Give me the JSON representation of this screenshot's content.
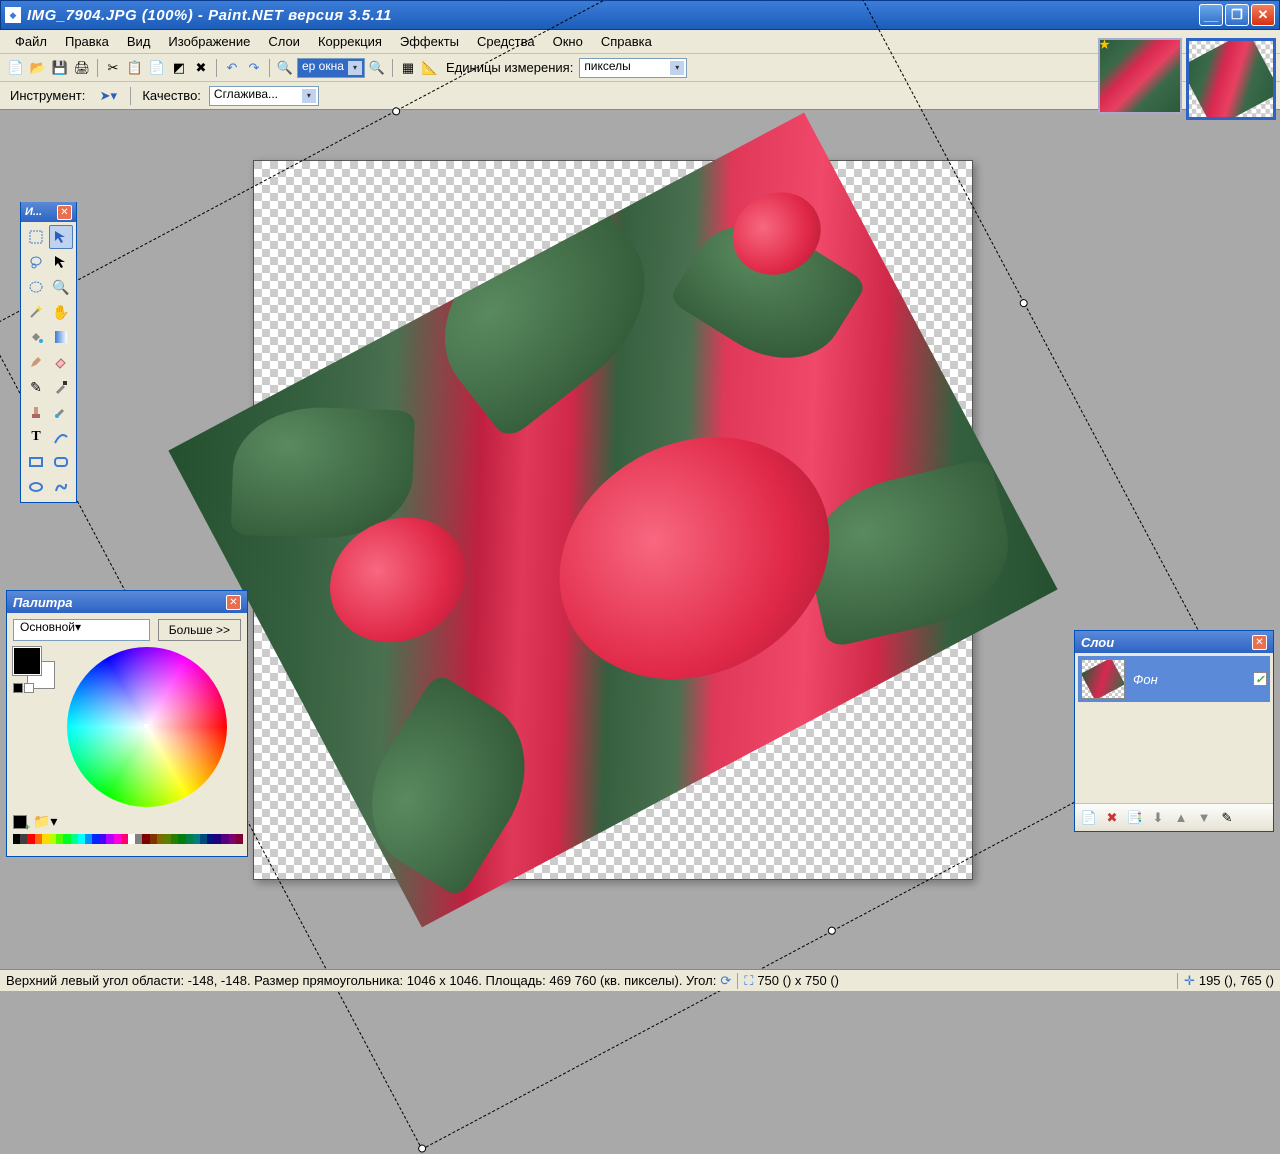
{
  "titlebar": {
    "text": "IMG_7904.JPG (100%) - Paint.NET версия 3.5.11"
  },
  "menu": {
    "items": [
      "Файл",
      "Правка",
      "Вид",
      "Изображение",
      "Слои",
      "Коррекция",
      "Эффекты",
      "Средства",
      "Окно",
      "Справка"
    ]
  },
  "toolbar1": {
    "zoom_combo": "ер окна",
    "units_label": "Единицы измерения:",
    "units_value": "пикселы"
  },
  "toolbar2": {
    "tool_label": "Инструмент:",
    "quality_label": "Качество:",
    "quality_value": "Сглажива..."
  },
  "tools_panel": {
    "title": "И..."
  },
  "colors_panel": {
    "title": "Палитра",
    "mode": "Основной",
    "more": "Больше >>"
  },
  "layers_panel": {
    "title": "Слои",
    "layer0": "Фон"
  },
  "status": {
    "region": "Верхний левый угол области: -148, -148. Размер прямоугольника: 1046 х 1046. Площадь: 469 760 (кв. пикселы). Угол:",
    "size": "750 () x 750 ()",
    "cursor": "195 (), 765 ()"
  },
  "swatch_colors": [
    "#000",
    "#404040",
    "#ff0000",
    "#ff6a00",
    "#ffd800",
    "#b6ff00",
    "#4cff00",
    "#00ff21",
    "#00ff90",
    "#00ffff",
    "#0094ff",
    "#0026ff",
    "#4800ff",
    "#b200ff",
    "#ff00dc",
    "#ff006e",
    "#ffffff",
    "#808080",
    "#7f0000",
    "#7f3300",
    "#7f6a00",
    "#5b7f00",
    "#267f00",
    "#007f0e",
    "#007f46",
    "#007f7f",
    "#004a7f",
    "#00137f",
    "#21007f",
    "#57007f",
    "#7f006e",
    "#7f0037"
  ]
}
